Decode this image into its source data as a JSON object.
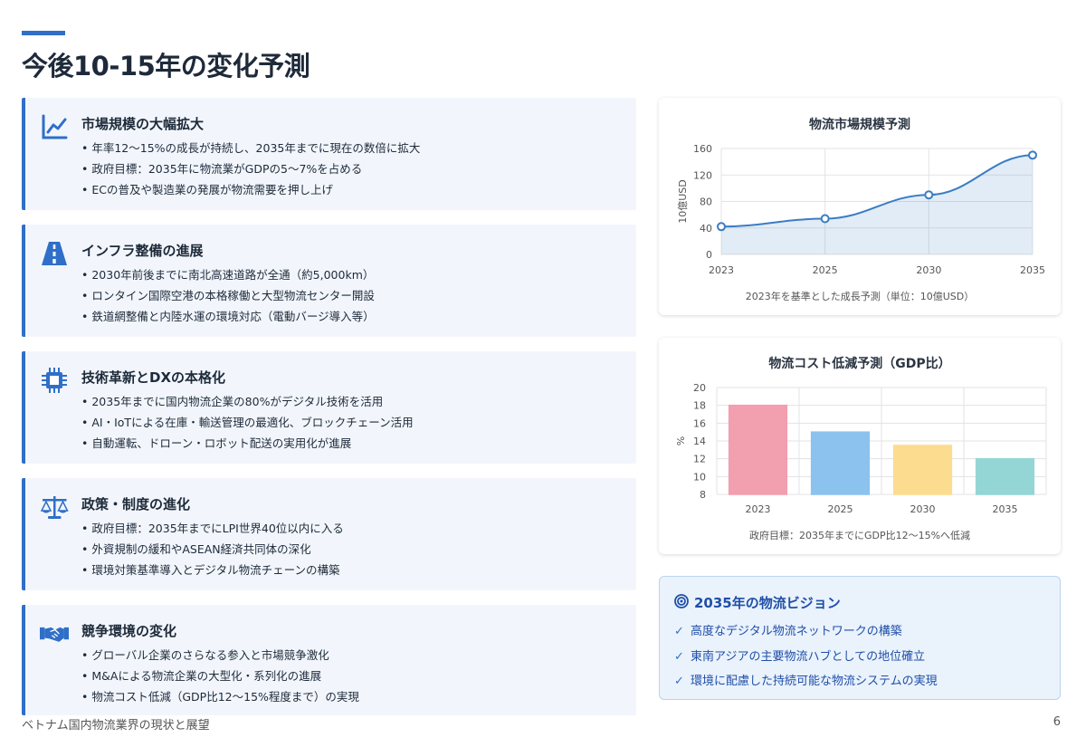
{
  "page": {
    "title": "今後10-15年の変化予測"
  },
  "cards": [
    {
      "title": "市場規模の大幅拡大",
      "icon": "line-chart-icon",
      "items": [
        "年率12〜15%の成長が持続し、2035年までに現在の数倍に拡大",
        "政府目標：2035年に物流業がGDPの5〜7%を占める",
        "ECの普及や製造業の発展が物流需要を押し上げ"
      ]
    },
    {
      "title": "インフラ整備の進展",
      "icon": "road-icon",
      "items": [
        "2030年前後までに南北高速道路が全通（約5,000km）",
        "ロンタイン国際空港の本格稼働と大型物流センター開設",
        "鉄道網整備と内陸水運の環境対応（電動バージ導入等）"
      ]
    },
    {
      "title": "技術革新とDXの本格化",
      "icon": "microchip-icon",
      "items": [
        "2035年までに国内物流企業の80%がデジタル技術を活用",
        "AI・IoTによる在庫・輸送管理の最適化、ブロックチェーン活用",
        "自動運転、ドローン・ロボット配送の実用化が進展"
      ]
    },
    {
      "title": "政策・制度の進化",
      "icon": "balance-scale-icon",
      "items": [
        "政府目標：2035年までにLPI世界40位以内に入る",
        "外資規制の緩和やASEAN経済共同体の深化",
        "環境対策基準導入とデジタル物流チェーンの構築"
      ]
    },
    {
      "title": "競争環境の変化",
      "icon": "handshake-icon",
      "items": [
        "グローバル企業のさらなる参入と市場競争激化",
        "M&Aによる物流企業の大型化・系列化の進展",
        "物流コスト低減（GDP比12〜15%程度まで）の実現"
      ]
    }
  ],
  "chart_data": [
    {
      "type": "area",
      "title": "物流市場規模予測",
      "x": [
        "2023",
        "2025",
        "2030",
        "2035"
      ],
      "values": [
        42,
        54,
        90,
        150
      ],
      "ylabel": "10億USD",
      "ylim": [
        0,
        160
      ],
      "yticks": [
        0,
        40,
        80,
        120,
        160
      ],
      "caption": "2023年を基準とした成長予測（単位：10億USD）",
      "grid": true,
      "color": "#3b7dc4"
    },
    {
      "type": "bar",
      "title": "物流コスト低減予測（GDP比）",
      "categories": [
        "2023",
        "2025",
        "2030",
        "2035"
      ],
      "values": [
        18,
        15,
        13.5,
        12
      ],
      "ylabel": "%",
      "ylim": [
        8,
        20
      ],
      "yticks": [
        8,
        10,
        12,
        14,
        16,
        18,
        20
      ],
      "caption": "政府目標：2035年までにGDP比12〜15%へ低減",
      "grid": true,
      "colors": [
        "#f29fb0",
        "#8cc2ee",
        "#fcdd8f",
        "#94d6d6"
      ]
    }
  ],
  "vision": {
    "title": "2035年の物流ビジョン",
    "icon": "bullseye-icon",
    "items": [
      "高度なデジタル物流ネットワークの構築",
      "東南アジアの主要物流ハブとしての地位確立",
      "環境に配慮した持続可能な物流システムの実現"
    ]
  },
  "footer": {
    "left": "ベトナム国内物流業界の現状と展望",
    "page_number": "6"
  }
}
